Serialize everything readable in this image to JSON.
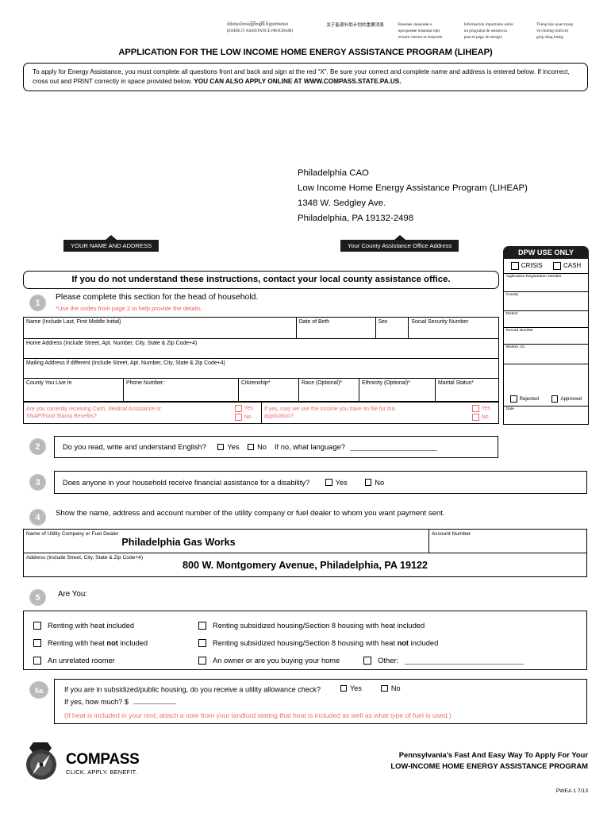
{
  "header": {
    "languages": [
      {
        "name": "khmer",
        "line1": "ព័ត៌មានសំខាន់ស្តីពីកម្មវិធី ជំនួយថាមពល",
        "line2": "(ENERGY ASSISTANCE PROGRAM)"
      },
      {
        "name": "chinese",
        "line1": "关于能源补助计划的重要消息"
      },
      {
        "name": "russian",
        "line1": "Важные сведения о",
        "line2": "программе помощи при",
        "line3": "оплате счетов за энергию"
      },
      {
        "name": "spanish",
        "line1": "Información importante sobre",
        "line2": "un programa de asistencia",
        "line3": "para el pago de energía"
      },
      {
        "name": "vietnamese",
        "line1": "Thông báo quan trọng",
        "line2": "về chương trình trợ",
        "line3": "giúp năng lượng"
      }
    ],
    "title": "APPLICATION FOR THE LOW INCOME HOME ENERGY ASSISTANCE PROGRAM (LIHEAP)"
  },
  "instructions": {
    "text_part1": "To apply for Energy Assistance, you must complete all questions front and back and sign at the red “X”. Be sure your correct and complete name and address is entered below. If incorrect, cross out and PRINT correctly in space provided below. ",
    "text_bold": "YOU CAN ALSO APPLY ONLINE AT WWW.COMPASS.STATE.PA.US."
  },
  "cao_address": {
    "line1": "Philadelphia CAO",
    "line2": "Low Income Home Energy Assistance Program (LIHEAP)",
    "line3": "1348 W. Sedgley Ave.",
    "line4": "Philadelphia, PA 19132-2498"
  },
  "callouts": {
    "name_address": "YOUR NAME AND ADDRESS",
    "cao_address": "Your County Assistance Office Address"
  },
  "dpw": {
    "title": "DPW USE ONLY",
    "crisis": "CRISIS",
    "cash": "CASH",
    "fields": [
      "Application Registration Number",
      "County",
      "District",
      "Record Number",
      "Worker I.D."
    ],
    "rejected": "Rejected",
    "approved": "Approved",
    "date": "Date"
  },
  "headline": "If you do not understand these instructions, contact your local county assistance office.",
  "section1": {
    "badge": "1",
    "title": "Please complete this section for the head of household.",
    "subtitle": "*Use the codes from page 2 to help provide the details.",
    "row1": [
      "Name (Include Last, First Middle Initial)",
      "Date of Birth",
      "Sex",
      "Social Security Number"
    ],
    "row2": "Home Address (Include Street, Apt. Number, City, State & Zip Code+4)",
    "row3": "Mailing Address if different (Include Street, Apt. Number, City, State & Zip Code+4)",
    "row4": [
      "County You Live In",
      "Phone Number:",
      "Citizenship*",
      "Race (Optional)*",
      "Ethnicity (Optional)*",
      "Marital Status*"
    ],
    "red_q1_line1": "Are you currently receiving Cash, Medical Assistance or",
    "red_q1_line2": "SNAP/Food Stamp Benefits?",
    "red_q2_line1": "If yes, may we use the income you have on file for this",
    "red_q2_line2": "application?",
    "yes": "Yes",
    "no": "No"
  },
  "section2": {
    "badge": "2",
    "question": "Do you read, write and understand English?",
    "yes": "Yes",
    "no": "No",
    "followup": "If no, what language?"
  },
  "section3": {
    "badge": "3",
    "question": "Does anyone in your household receive financial assistance for a disability?",
    "yes": "Yes",
    "no": "No"
  },
  "section4": {
    "badge": "4",
    "title": "Show the name, address and account number of the utility company or fuel dealer to whom you want payment sent.",
    "name_label": "Name of Utility Company or Fuel Dealer",
    "name_value": "Philadelphia Gas Works",
    "account_label": "Account Number",
    "account_value": "",
    "address_label": "Address (Include Street, City, State & Zip Code+4)",
    "address_value": "800 W. Montgomery Avenue, Philadelphia, PA 19122"
  },
  "section5": {
    "badge": "5",
    "title": "Are You:",
    "options": [
      {
        "col": 1,
        "pre": "Renting with heat included",
        "bold": "",
        "post": ""
      },
      {
        "col": 2,
        "pre": "Renting subsidized housing/Section 8 housing with heat included",
        "bold": "",
        "post": ""
      },
      {
        "col": 1,
        "pre": "Renting with heat ",
        "bold": "not",
        "post": " included"
      },
      {
        "col": 2,
        "pre": "Renting subsidized housing/Section 8 housing with heat ",
        "bold": "not",
        "post": " included"
      },
      {
        "col": 1,
        "pre": "An unrelated roomer",
        "bold": "",
        "post": ""
      },
      {
        "col": 2,
        "pre": "An owner or are you buying your home",
        "bold": "",
        "post": ""
      }
    ],
    "other": "Other:"
  },
  "section5a": {
    "badge": "5a",
    "question": "If you are in subsidized/public housing, do you receive a utility allowance check?",
    "yes": "Yes",
    "no": "No",
    "howmuch": "If yes, how much? $",
    "note": "(If heat is included in your rent, attach a note from your landlord stating that heat is included as well as what type of fuel is used.)"
  },
  "footer": {
    "logo_name": "COMPASS",
    "logo_tagline": "CLICK. APPLY. BENEFIT.",
    "tagline_line1": "Pennsylvania's Fast And Easy Way To Apply For Your",
    "tagline_line2": "LOW-INCOME HOME ENERGY ASSISTANCE PROGRAM",
    "form_code": "PWEA 1   7/13"
  },
  "colors": {
    "red": "#f06a6a",
    "red_text": "#f05a5a",
    "badge_gray": "#b9b9b9",
    "dark": "#1c1c1c"
  }
}
